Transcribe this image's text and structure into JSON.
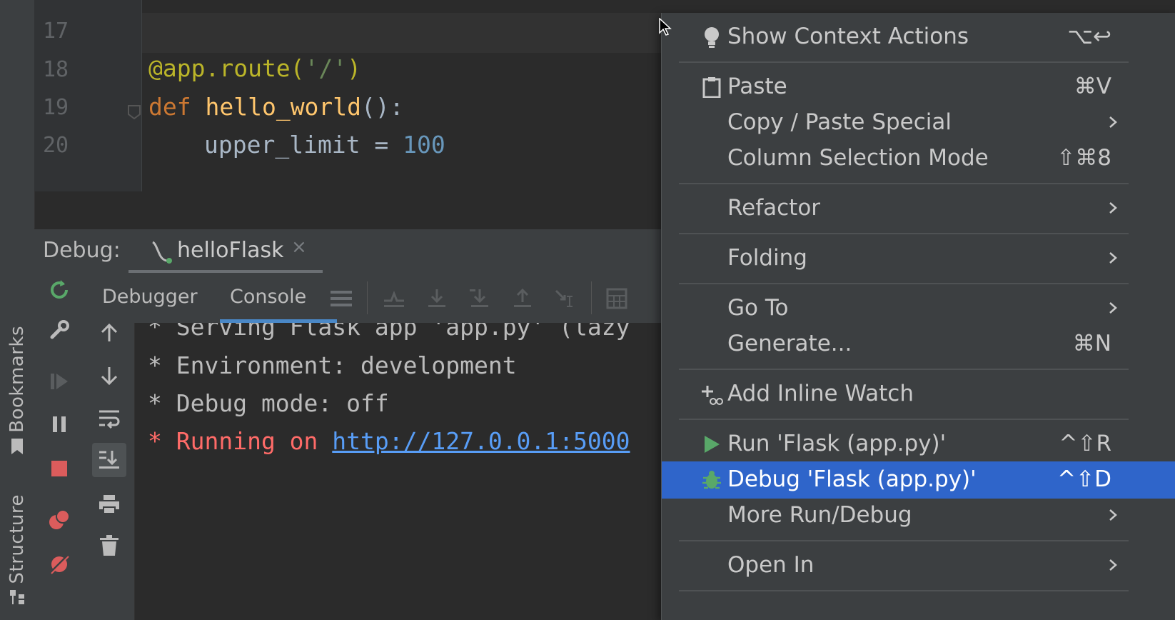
{
  "editor": {
    "line_numbers": [
      "17",
      "18",
      "19",
      "20"
    ],
    "code": {
      "line18": {
        "decorator": "@app.route(",
        "route": "'/'",
        "close": ")"
      },
      "line19": {
        "keyword": "def",
        "func": "hello_world",
        "rest": "():"
      },
      "line20": {
        "var": "upper_limit = ",
        "num": "100"
      }
    }
  },
  "debug": {
    "label": "Debug:",
    "tab_name": "helloFlask",
    "tab_close": "×",
    "subtabs": {
      "debugger": "Debugger",
      "console": "Console"
    },
    "console_lines": [
      "* Serving Flask app 'app.py' (lazy",
      "* Environment: development",
      "* Debug mode: off"
    ],
    "running": {
      "prefix": "* Running on ",
      "url": "http://127.0.0.1:5000"
    }
  },
  "left_strip": {
    "bookmarks": "Bookmarks",
    "structure": "Structure"
  },
  "context_menu": {
    "items": [
      {
        "label": "Show Context Actions",
        "shortcut": "⌥↩",
        "icon": "bulb-icon"
      },
      {
        "label": "Paste",
        "shortcut": "⌘V",
        "icon": "clipboard-icon"
      },
      {
        "label": "Copy / Paste Special",
        "shortcut": "",
        "submenu": true
      },
      {
        "label": "Column Selection Mode",
        "shortcut": "⇧⌘8"
      },
      {
        "label": "Refactor",
        "submenu": true
      },
      {
        "label": "Folding",
        "submenu": true
      },
      {
        "label": "Go To",
        "submenu": true
      },
      {
        "label": "Generate...",
        "shortcut": "⌘N"
      },
      {
        "label": "Add Inline Watch",
        "icon": "add-watch-icon"
      },
      {
        "label": "Run 'Flask (app.py)'",
        "shortcut": "^⇧R",
        "icon": "run-icon"
      },
      {
        "label": "Debug 'Flask (app.py)'",
        "shortcut": "^⇧D",
        "icon": "debug-bug-icon",
        "selected": true
      },
      {
        "label": "More Run/Debug",
        "submenu": true
      },
      {
        "label": "Open In",
        "submenu": true
      }
    ]
  },
  "colors": {
    "accent_selected": "#2f65ca",
    "run_green": "#59a869",
    "stop_red": "#db5c5c",
    "link_blue": "#589df6",
    "error_red": "#ff6b68"
  }
}
